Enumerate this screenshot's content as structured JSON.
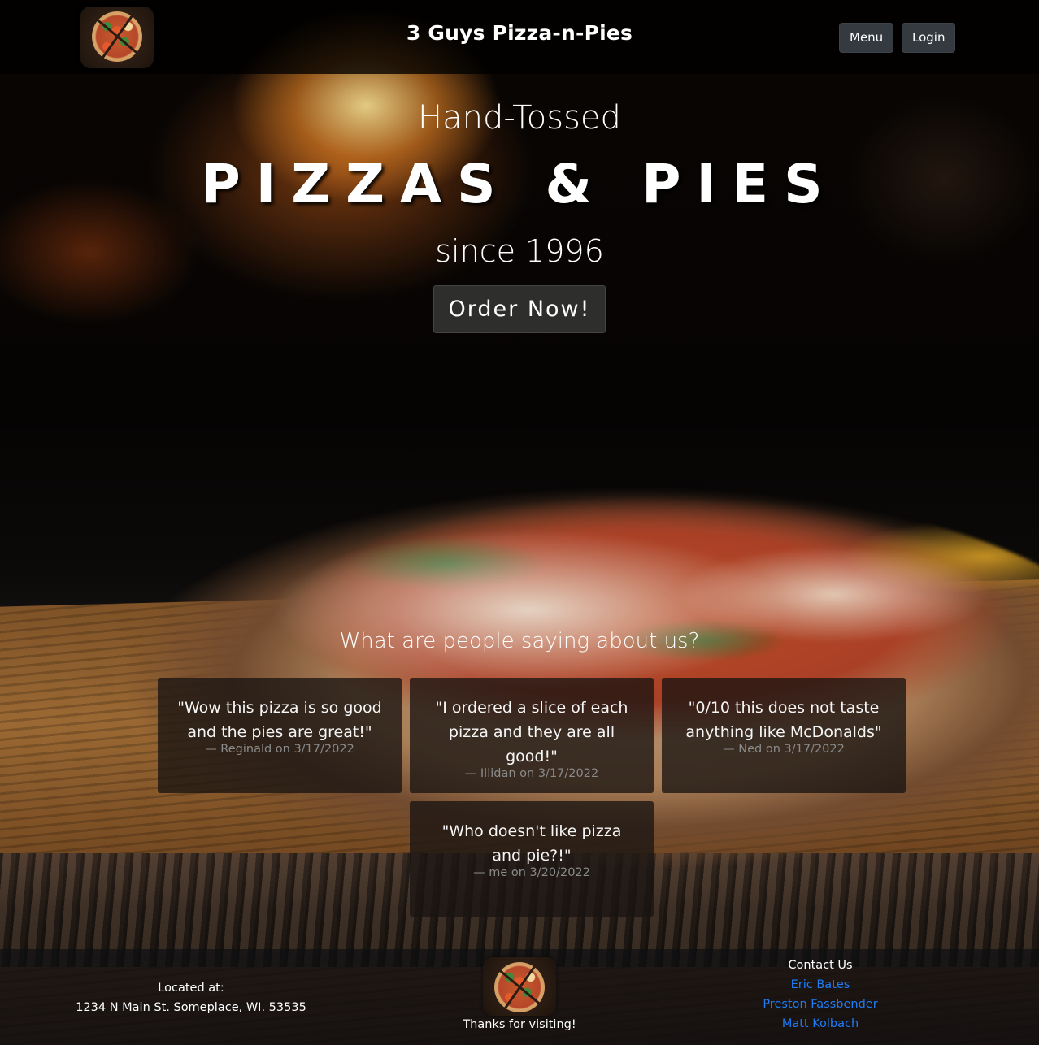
{
  "header": {
    "brand": "3 Guys Pizza-n-Pies",
    "nav": {
      "menu": "Menu",
      "login": "Login"
    },
    "logo_icon": "pizza-logo-icon"
  },
  "hero": {
    "line1": "Hand-Tossed",
    "title": "PIZZAS & PIES",
    "line3": "since 1996",
    "cta": "Order Now!"
  },
  "reviews": {
    "heading": "What are people saying about us?",
    "items": [
      {
        "quote": "\"Wow this pizza is so good and the pies are great!\"",
        "author": "—  Reginald on 3/17/2022"
      },
      {
        "quote": "\"I ordered a slice of each pizza and they are all good!\"",
        "author": "—  Illidan on 3/17/2022"
      },
      {
        "quote": "\"0/10 this does not taste anything like McDonalds\"",
        "author": "—  Ned on 3/17/2022"
      },
      {
        "quote": "\"Who doesn't like pizza and pie?!\"",
        "author": "—  me on 3/20/2022"
      }
    ]
  },
  "footer": {
    "location_label": "Located at:",
    "address": "1234 N Main St. Someplace, WI. 53535",
    "thanks": "Thanks for visiting!",
    "contact_heading": "Contact Us",
    "contacts": [
      "Eric Bates",
      "Preston Fassbender",
      "Matt Kolbach"
    ],
    "link_color": "#1e7cf5"
  }
}
